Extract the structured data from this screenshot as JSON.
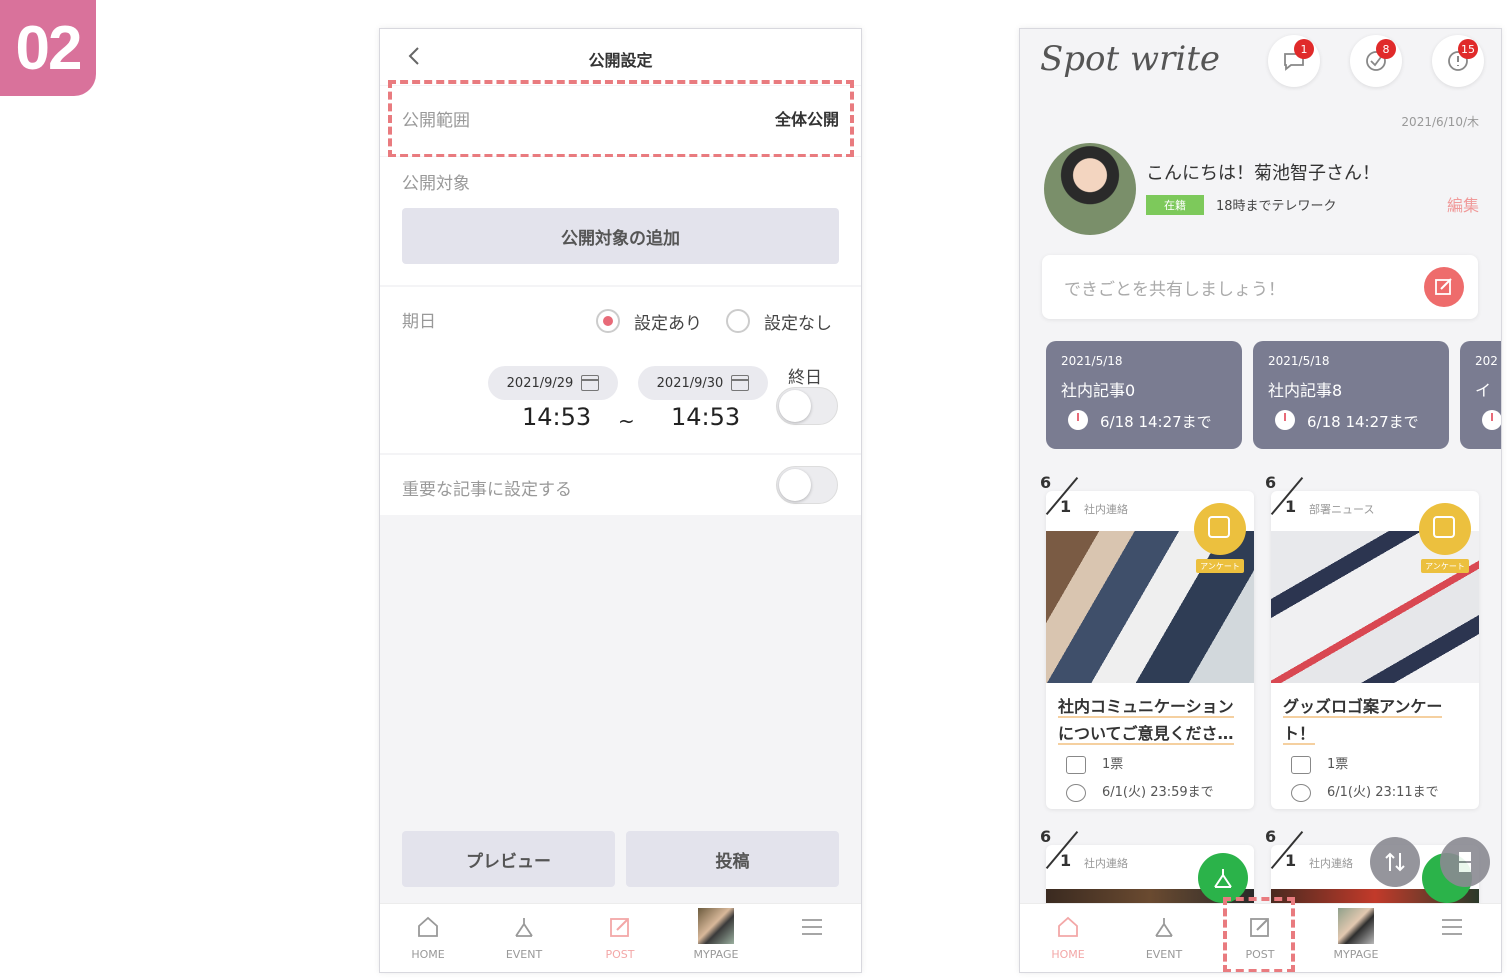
{
  "step_badge": "02",
  "left_screen": {
    "title": "公開設定",
    "scope_label": "公開範囲",
    "scope_value": "全体公開",
    "target_label": "公開対象",
    "add_target_button": "公開対象の追加",
    "due_label": "期日",
    "radio_set": "設定あり",
    "radio_unset": "設定なし",
    "start_date": "2021/9/29",
    "end_date": "2021/9/30",
    "start_time": "14:53",
    "end_time": "14:53",
    "range_sep": "~",
    "all_day_label": "終日",
    "important_label": "重要な記事に設定する",
    "preview_button": "プレビュー",
    "post_button": "投稿",
    "tabs": [
      "HOME",
      "EVENT",
      "POST",
      "MYPAGE"
    ]
  },
  "right_screen": {
    "logo": "Spot write",
    "notification_counts": [
      "1",
      "8",
      "15"
    ],
    "date": "2021/6/10/木",
    "greeting": "こんにちは！菊池智子さん！",
    "status_badge": "在籍",
    "status_text": "18時までテレワーク",
    "edit_link": "編集",
    "share_placeholder": "できごとを共有しましょう！",
    "deadline_cards": [
      {
        "date": "2021/5/18",
        "title": "社内記事0",
        "deadline": "6/18 14:27まで"
      },
      {
        "date": "2021/5/18",
        "title": "社内記事8",
        "deadline": "6/18 14:27まで"
      },
      {
        "date": "202",
        "title": "イ"
      }
    ],
    "articles": [
      {
        "month": "6",
        "day": "1",
        "category": "社内連絡",
        "badge": "アンケート",
        "title_line1": "社内コミュニケーション",
        "title_line2": "についてご意見くださ…",
        "votes": "1票",
        "deadline": "6/1(火) 23:59まで"
      },
      {
        "month": "6",
        "day": "1",
        "category": "部署ニュース",
        "badge": "アンケート",
        "title_line1": "グッズロゴ案アンケー",
        "title_line2": "ト！",
        "votes": "1票",
        "deadline": "6/1(火) 23:11まで"
      },
      {
        "month": "6",
        "day": "1",
        "category": "社内連絡"
      },
      {
        "month": "6",
        "day": "1",
        "category": "社内連絡"
      }
    ],
    "tabs": [
      "HOME",
      "EVENT",
      "POST",
      "MYPAGE"
    ]
  },
  "colors": {
    "accent": "#e86a78",
    "badge": "#d9729b",
    "card": "#7a7c91",
    "survey": "#ecc03e",
    "fab_green": "#2bb34a",
    "highlight": "#e97b7f"
  }
}
